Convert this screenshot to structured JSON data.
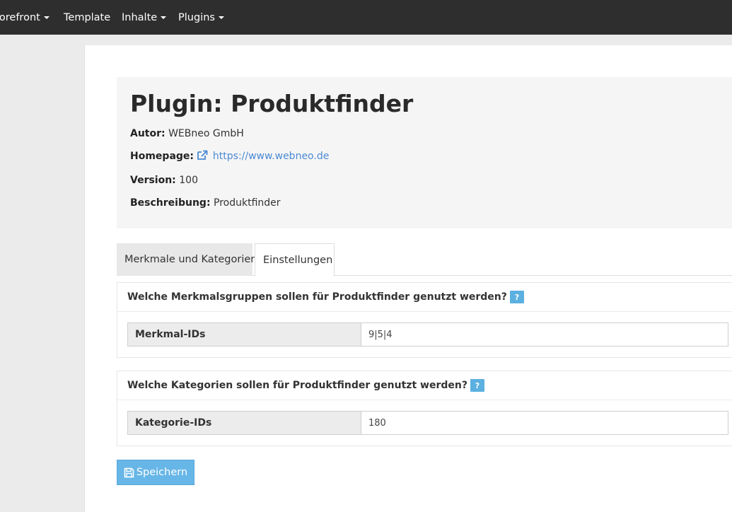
{
  "nav": {
    "items": [
      {
        "label": "Storefront",
        "has_dropdown": true
      },
      {
        "label": "Template",
        "has_dropdown": false
      },
      {
        "label": "Inhalte",
        "has_dropdown": true
      },
      {
        "label": "Plugins",
        "has_dropdown": true
      }
    ]
  },
  "plugin": {
    "title": "Plugin: Produktfinder",
    "author_label": "Autor:",
    "author_value": "WEBneo GmbH",
    "homepage_label": "Homepage:",
    "homepage_url": "https://www.webneo.de",
    "version_label": "Version:",
    "version_value": "100",
    "description_label": "Beschreibung:",
    "description_value": "Produktfinder"
  },
  "tabs": [
    {
      "label": "Merkmale und Kategorien",
      "active": false
    },
    {
      "label": "Einstellungen",
      "active": true
    }
  ],
  "panels": [
    {
      "heading": "Welche Merkmalsgruppen sollen für Produktfinder genutzt werden?",
      "field_label": "Merkmal-IDs",
      "field_value": "9|5|4"
    },
    {
      "heading": "Welche Kategorien sollen für Produktfinder genutzt werden?",
      "field_label": "Kategorie-IDs",
      "field_value": "180"
    }
  ],
  "help_icon_text": "?",
  "save_button": {
    "label": "Speichern"
  },
  "colors": {
    "navbar": "#2e2e2e",
    "link": "#4a8ad4",
    "help": "#5bb0e0",
    "primary_button": "#67b6e8"
  }
}
